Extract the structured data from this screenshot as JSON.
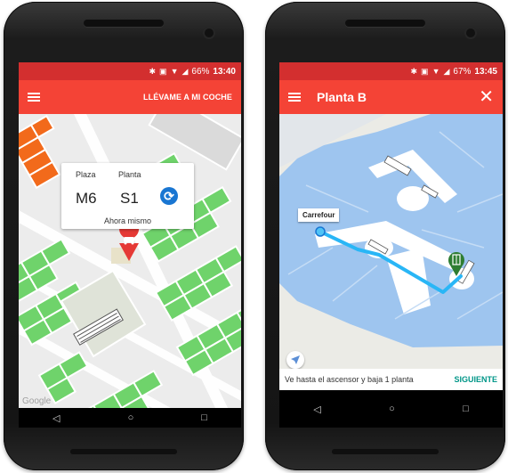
{
  "left_phone": {
    "status": {
      "battery": "66%",
      "time": "13:40"
    },
    "appbar": {
      "action_label": "LLÉVAME A MI COCHE"
    },
    "card": {
      "plaza_label": "Plaza",
      "planta_label": "Planta",
      "plaza_value": "M6",
      "planta_value": "S1",
      "footer": "Ahora mismo"
    },
    "map": {
      "attribution": "Google"
    },
    "nav": {
      "back": "◁",
      "home": "○",
      "recents": "□"
    }
  },
  "right_phone": {
    "status": {
      "battery": "67%",
      "time": "13:45"
    },
    "appbar": {
      "title": "Planta B",
      "close": "✕"
    },
    "map": {
      "marker_label": "Carrefour"
    },
    "instruction": {
      "text": "Ve hasta el ascensor y baja 1 planta",
      "next_label": "SIGUIENTE"
    },
    "nav": {
      "back": "◁",
      "home": "○",
      "recents": "□"
    }
  },
  "colors": {
    "statusbar": "#d32f2f",
    "appbar": "#f44336",
    "parking_green": "#6fd36b",
    "parking_orange": "#f26a1b",
    "floor_blue": "#9ec5ef",
    "route_blue": "#29b6f6",
    "accent_teal": "#009688",
    "refresh_blue": "#1976d2"
  },
  "icons": [
    "hamburger-icon",
    "refresh-icon",
    "car-pin-icon",
    "close-icon",
    "location-dot-icon",
    "parking-pin-icon",
    "navigation-arrow-icon",
    "back-icon",
    "home-icon",
    "recents-icon"
  ]
}
